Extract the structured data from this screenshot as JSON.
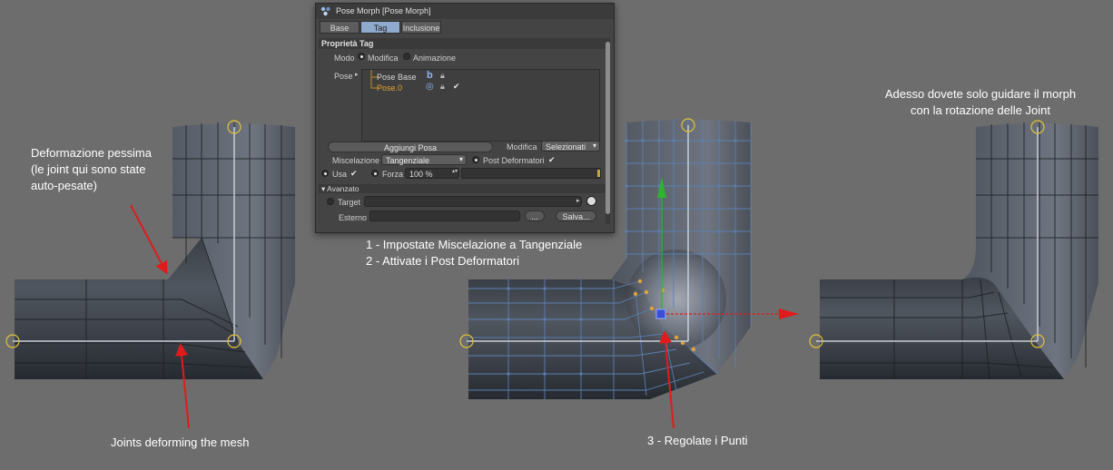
{
  "annotations": {
    "left_line1": "Deformazione pessima",
    "left_line2": "(le joint qui sono state",
    "left_line3": "auto-pesate)",
    "left_bottom": "Joints deforming the mesh",
    "mid_step1": "1 - Impostate Miscelazione a Tangenziale",
    "mid_step2": "2 - Attivate i Post Deformatori",
    "mid_step3": "3 - Regolate i Punti",
    "right_line1": "Adesso dovete solo guidare il morph",
    "right_line2": "con la rotazione delle Joint"
  },
  "panel": {
    "title": "Pose Morph [Pose Morph]",
    "tabs": [
      {
        "label": "Base",
        "active": false
      },
      {
        "label": "Tag",
        "active": true
      },
      {
        "label": "Inclusione",
        "active": false
      }
    ],
    "section": "Proprietà Tag",
    "mode_label": "Modo",
    "mode_edit": "Modifica",
    "mode_anim": "Animazione",
    "pose_label": "Pose",
    "poses": [
      {
        "name": "Pose Base",
        "icon": "b"
      },
      {
        "name": "Pose.0",
        "icon": "◎"
      }
    ],
    "add_pose": "Aggiungi Posa",
    "modify_label": "Modifica",
    "modify_value": "Selezionati",
    "blend_label": "Miscelazione",
    "blend_value": "Tangenziale",
    "post_deformers": "Post Deformatori",
    "use_label": "Usa",
    "strength_label": "Forza",
    "strength_value": "100 %",
    "advanced": "Avanzato",
    "target_label": "Target",
    "external_label": "Esterno",
    "ellipsis_button": "...",
    "save_button": "Salva..."
  },
  "colors": {
    "background": "#6d6d6d",
    "arrow": "#e11b1b",
    "axis_y": "#2cb52c",
    "joint": "#e0c23a",
    "mesh_wire_selected": "#5b7fb0"
  }
}
